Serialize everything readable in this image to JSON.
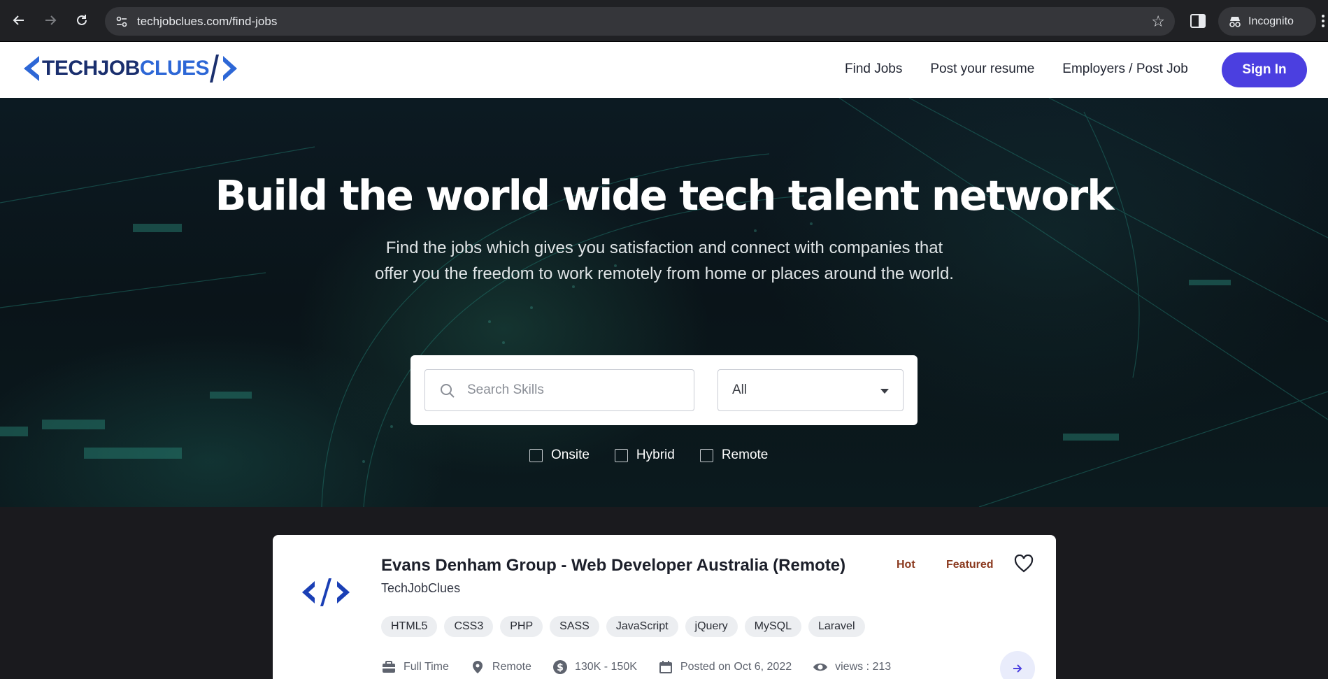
{
  "browser": {
    "url": "techjobclues.com/find-jobs",
    "profile_label": "Incognito"
  },
  "header": {
    "logo_tech": "TECHJOB",
    "logo_clues": "CLUES",
    "nav": [
      "Find Jobs",
      "Post your resume",
      "Employers / Post Job"
    ],
    "signin_label": "Sign In"
  },
  "hero": {
    "title": "Build the world wide tech talent network",
    "subtitle": "Find the jobs which gives you satisfaction and connect with companies that offer you the freedom to work remotely from home or places around the world.",
    "search_placeholder": "Search Skills",
    "select_value": "All",
    "filters": [
      "Onsite",
      "Hybrid",
      "Remote"
    ]
  },
  "job": {
    "title": "Evans Denham Group - Web Developer Australia (Remote)",
    "company": "TechJobClues",
    "badge_hot": "Hot",
    "badge_featured": "Featured",
    "tags": [
      "HTML5",
      "CSS3",
      "PHP",
      "SASS",
      "JavaScript",
      "jQuery",
      "MySQL",
      "Laravel"
    ],
    "job_type": "Full Time",
    "location": "Remote",
    "salary": "130K - 150K",
    "posted": "Posted on Oct 6, 2022",
    "views": "views : 213"
  },
  "colors": {
    "brand_primary": "#4b3fe0",
    "logo_dark": "#1a2f6e",
    "logo_blue": "#2d67d6",
    "badge": "#8b3a1f"
  }
}
